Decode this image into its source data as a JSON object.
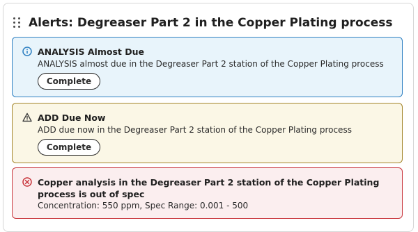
{
  "panel": {
    "title": "Alerts: Degreaser Part 2 in the Copper Plating process"
  },
  "alerts": [
    {
      "type": "info",
      "icon": "info-circle-icon",
      "title": "ANALYSIS Almost Due",
      "message": "ANALYSIS almost due in the Degreaser Part 2 station of the Copper Plating process",
      "button_label": "Complete",
      "color": "#2d7fc1"
    },
    {
      "type": "warning",
      "icon": "warning-triangle-icon",
      "title": "ADD Due Now",
      "message": "ADD due now in the Degreaser Part 2 station of the Copper Plating process",
      "button_label": "Complete",
      "color": "#a3852a"
    },
    {
      "type": "error",
      "icon": "error-x-circle-icon",
      "title": "Copper analysis in the Degreaser Part 2 station of the Copper Plating process is out of spec",
      "message": "Concentration: 550 ppm, Spec Range: 0.001 - 500",
      "color": "#c8353c"
    }
  ]
}
